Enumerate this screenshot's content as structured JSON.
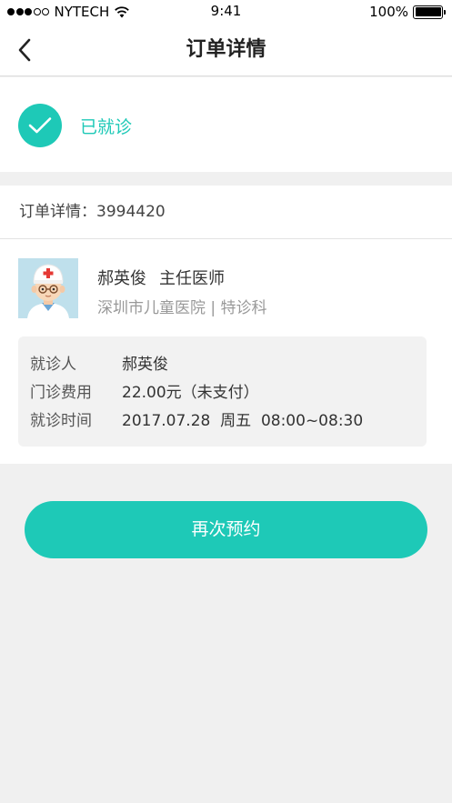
{
  "status_bar": {
    "carrier": "NYTECH",
    "time": "9:41",
    "battery": "100%"
  },
  "nav": {
    "title": "订单详情",
    "back_icon": "chevron-left-icon"
  },
  "order_status": {
    "label": "已就诊",
    "icon": "check-circle-icon"
  },
  "order": {
    "number_label": "订单详情：",
    "number": "3994420"
  },
  "doctor": {
    "name": "郝英俊",
    "title": "主任医师",
    "hospital_line": "深圳市儿童医院 | 特诊科"
  },
  "visit_info": [
    {
      "label": "就诊人",
      "value": "郝英俊"
    },
    {
      "label": "门诊费用",
      "value": "22.00元（未支付）"
    },
    {
      "label": "就诊时间",
      "value": "2017.07.28  周五  08:00~08:30"
    }
  ],
  "actions": {
    "rebook_label": "再次预约"
  },
  "colors": {
    "accent": "#1ec9b7",
    "background": "#f0f0f0"
  }
}
